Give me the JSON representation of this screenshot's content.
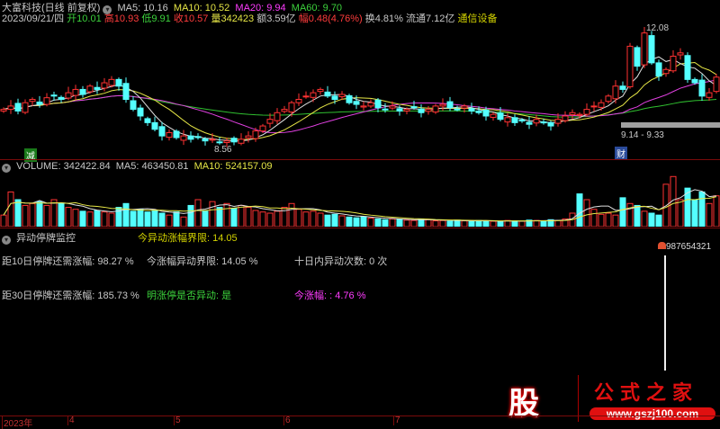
{
  "header": {
    "title": "大富科技(日线 前复权)",
    "ma5": "MA5: 10.16",
    "ma10": "MA10: 10.52",
    "ma20": "MA20: 9.94",
    "ma60": "MA60: 9.70",
    "date": "2023/09/21/四",
    "open": "开10.01",
    "high": "高10.93",
    "low": "低9.91",
    "close": "收10.57",
    "vol": "量342423",
    "amount": "额3.59亿",
    "change": "幅0.48(4.76%)",
    "turnover": "换4.81%",
    "float": "流通7.12亿",
    "sector": "通信设备"
  },
  "annotations": {
    "max": "12.08",
    "min": "8.56",
    "range": "9.14 - 9.33",
    "badge_left": "减",
    "badge_right": "财"
  },
  "volume_header": {
    "vol": "VOLUME: 342422.84",
    "ma5": "MA5: 463450.81",
    "ma10": "MA10: 524157.09"
  },
  "indicator": {
    "title": "异动停牌监控",
    "threshold": "今异动涨幅界限: 14.05",
    "l1": "距10日停牌还需涨幅: 98.27 %",
    "l2": "今涨幅异动界限: 14.05 %",
    "l3": "十日内异动次数: 0 次",
    "l4": "距30日停牌还需涨幅: 185.73 %",
    "l5": "明涨停是否异动: 是",
    "l6": "今涨幅: : 4.76 %",
    "marker": "987654321"
  },
  "axis": {
    "labels": [
      "2023年",
      "4",
      "5",
      "6",
      "7"
    ]
  },
  "logo": {
    "char": "股",
    "name": "公式之家",
    "url": "www.gszj100.com"
  },
  "colors": {
    "up": "#ff3232",
    "down": "#54ffff",
    "ma5": "#e0e0e0",
    "ma10": "#e6e646",
    "ma20": "#e040e0",
    "ma60": "#30c030"
  },
  "chart_data": {
    "type": "candlestick",
    "closes": [
      9.6,
      9.7,
      9.55,
      9.8,
      9.9,
      9.75,
      9.95,
      10.0,
      9.9,
      10.1,
      10.2,
      10.05,
      10.3,
      10.2,
      10.4,
      10.5,
      10.3,
      9.9,
      9.6,
      9.4,
      9.2,
      9.0,
      8.8,
      8.9,
      8.75,
      8.8,
      8.7,
      8.75,
      8.65,
      8.7,
      8.6,
      8.65,
      8.62,
      8.7,
      8.8,
      8.95,
      9.1,
      9.3,
      9.5,
      9.6,
      9.8,
      9.9,
      10.0,
      10.1,
      10.2,
      10.0,
      9.9,
      10.05,
      9.8,
      9.75,
      9.7,
      9.8,
      9.65,
      9.6,
      9.7,
      9.55,
      9.6,
      9.65,
      9.5,
      9.6,
      9.7,
      9.75,
      9.65,
      9.6,
      9.7,
      9.55,
      9.5,
      9.4,
      9.45,
      9.3,
      9.35,
      9.2,
      9.25,
      9.15,
      9.3,
      9.2,
      9.1,
      9.3,
      9.4,
      9.5,
      9.45,
      9.6,
      9.7,
      9.8,
      10.0,
      10.3,
      10.2,
      11.5,
      10.9,
      11.9,
      11.0,
      10.6,
      10.8,
      11.2,
      11.3,
      10.5,
      10.4,
      10.0,
      10.1,
      10.57
    ],
    "volumes": [
      300,
      900,
      700,
      550,
      600,
      650,
      550,
      700,
      600,
      500,
      450,
      400,
      380,
      420,
      380,
      350,
      500,
      600,
      400,
      450,
      380,
      420,
      350,
      300,
      380,
      250,
      550,
      700,
      400,
      650,
      500,
      600,
      480,
      550,
      500,
      420,
      380,
      350,
      400,
      500,
      600,
      450,
      380,
      400,
      350,
      300,
      320,
      280,
      250,
      230,
      260,
      220,
      200,
      180,
      200,
      190,
      170,
      160,
      200,
      180,
      150,
      160,
      140,
      170,
      150,
      140,
      160,
      150,
      140,
      130,
      160,
      150,
      140,
      170,
      160,
      150,
      180,
      160,
      200,
      350,
      850,
      700,
      450,
      320,
      350,
      300,
      750,
      600,
      550,
      400,
      350,
      300,
      1100,
      1300,
      700,
      1000,
      700,
      900,
      600,
      800
    ]
  }
}
